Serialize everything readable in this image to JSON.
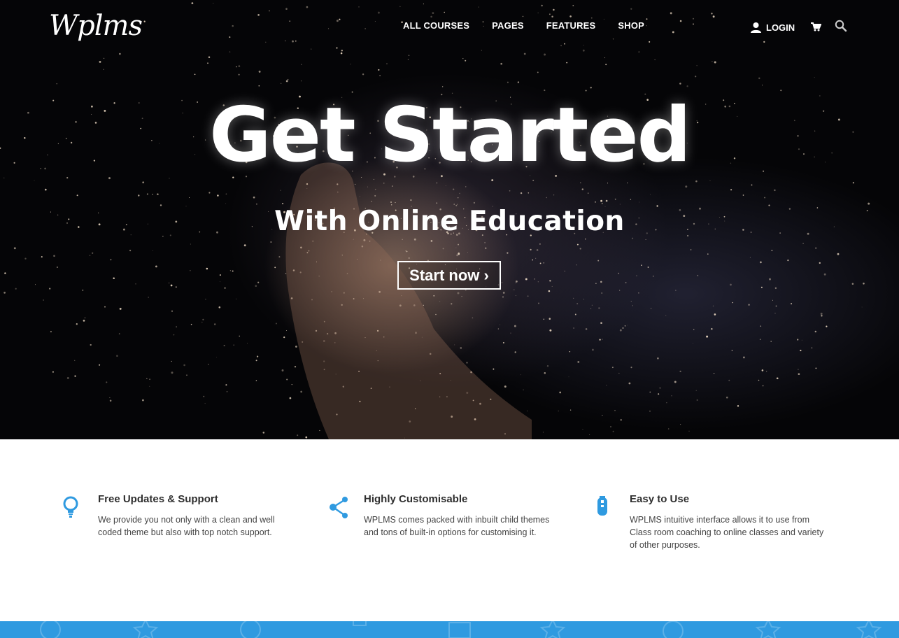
{
  "header": {
    "logo_text": "Wplms",
    "nav": [
      "ALL COURSES",
      "PAGES",
      "FEATURES",
      "SHOP"
    ],
    "login_label": "LOGIN",
    "icons": {
      "user": "user-icon",
      "cart": "cart-icon",
      "search": "search-icon"
    }
  },
  "hero": {
    "title": "Get Started",
    "subtitle": "With Online Education",
    "cta_label": "Start now ›"
  },
  "features": [
    {
      "icon": "lightbulb-icon",
      "title": "Free Updates & Support",
      "text": "We provide you not only with a clean and well coded theme but also with top notch support."
    },
    {
      "icon": "share-icon",
      "title": "Highly Customisable",
      "text": "WPLMS comes packed with inbuilt child themes and tons of built-in options for customising it."
    },
    {
      "icon": "test-tube-icon",
      "title": "Easy to Use",
      "text": "WPLMS intuitive interface allows it to use from Class room coaching to online classes and variety of other purposes."
    }
  ],
  "colors": {
    "accent": "#2f9ae0",
    "hero_bg": "#050507",
    "heading": "#2f2f2f",
    "body_text": "#444444"
  }
}
